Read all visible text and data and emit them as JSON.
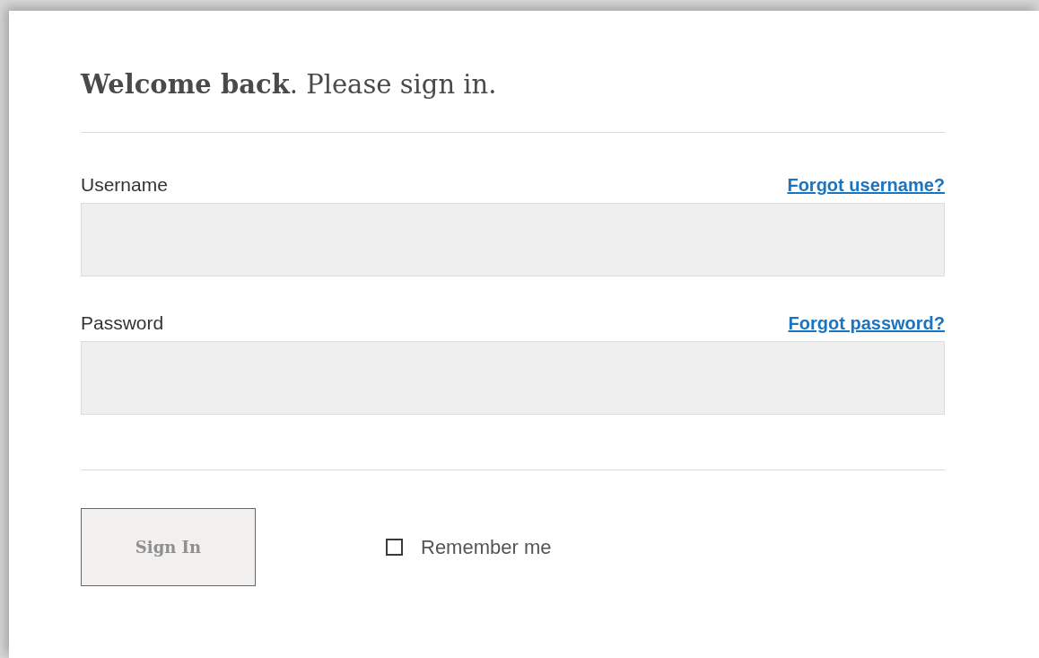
{
  "heading": "**Welcome back**. Please sign in.",
  "fields": [
    {
      "label": "Username",
      "link": "Forgot username?"
    },
    {
      "label": "Password",
      "link": "Forgot password?"
    }
  ],
  "submit": {
    "label": "Sign In",
    "disabled": true
  },
  "remember": {
    "label": "Remember me",
    "checked": false
  }
}
